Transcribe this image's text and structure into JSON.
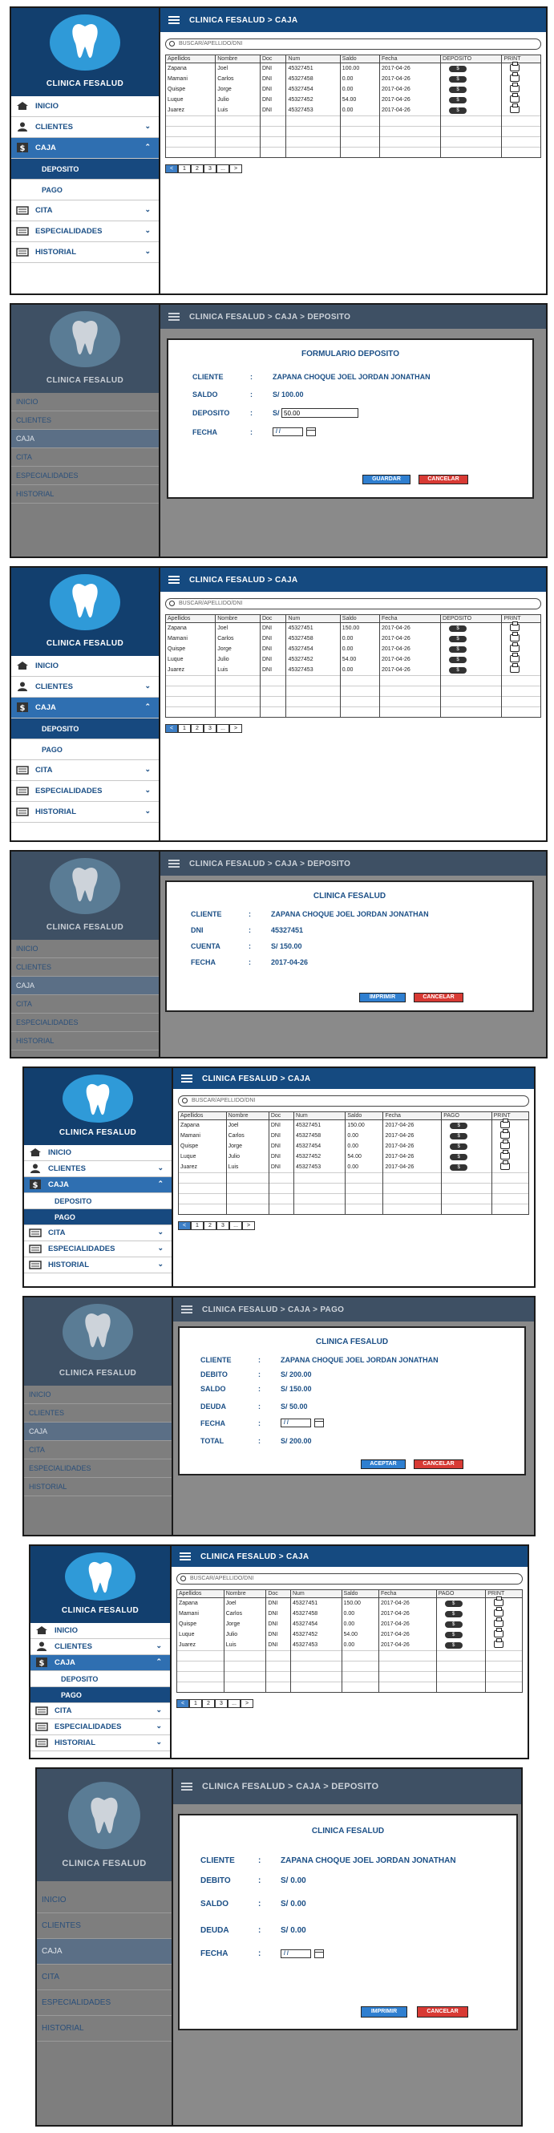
{
  "app": {
    "name": "CLINICA FESALUD"
  },
  "nav": {
    "inicio": "INICIO",
    "clientes": "CLIENTES",
    "caja": "CAJA",
    "deposito": "DEPOSITO",
    "pago": "PAGO",
    "cita": "CITA",
    "especialidades": "ESPECIALIDADES",
    "historial": "HISTORIAL"
  },
  "breadcrumbs": {
    "caja": "CLINICA FESALUD  >  CAJA",
    "deposito": "CLINICA FESALUD  >  CAJA  >  DEPOSITO",
    "pago": "CLINICA FESALUD  >  CAJA  >  PAGO"
  },
  "search": {
    "placeholder": "BUSCAR/APELLIDO/DNI"
  },
  "table": {
    "headers": [
      "Apellidos",
      "Nombre",
      "Doc",
      "Num",
      "Saldo",
      "Fecha",
      "DEPOSITO",
      "PRINT"
    ],
    "headers_pago": [
      "Apellidos",
      "Nombre",
      "Doc",
      "Num",
      "Saldo",
      "Fecha",
      "PAGO",
      "PRINT"
    ],
    "rows": [
      [
        "Zapana",
        "Joel",
        "DNI",
        "45327451",
        "100.00",
        "2017-04-26"
      ],
      [
        "Mamani",
        "Carlos",
        "DNI",
        "45327458",
        "0.00",
        "2017-04-26"
      ],
      [
        "Quispe",
        "Jorge",
        "DNI",
        "45327454",
        "0.00",
        "2017-04-26"
      ],
      [
        "Luque",
        "Julio",
        "DNI",
        "45327452",
        "54.00",
        "2017-04-26"
      ],
      [
        "Juarez",
        "Luis",
        "DNI",
        "45327453",
        "0.00",
        "2017-04-26"
      ]
    ],
    "rows_s3": [
      [
        "Zapana",
        "Joel",
        "DNI",
        "45327451",
        "150.00",
        "2017-04-26"
      ],
      [
        "Mamani",
        "Carlos",
        "DNI",
        "45327458",
        "0.00",
        "2017-04-26"
      ],
      [
        "Quispe",
        "Jorge",
        "DNI",
        "45327454",
        "0.00",
        "2017-04-26"
      ],
      [
        "Luque",
        "Julio",
        "DNI",
        "45327452",
        "54.00",
        "2017-04-26"
      ],
      [
        "Juarez",
        "Luis",
        "DNI",
        "45327453",
        "0.00",
        "2017-04-26"
      ]
    ],
    "action_label": "$"
  },
  "pager": [
    "<",
    "1",
    "2",
    "3",
    "...",
    ">"
  ],
  "deposito_form": {
    "title": "FORMULARIO DEPOSITO",
    "cliente_label": "CLIENTE",
    "cliente_value": "ZAPANA CHOQUE JOEL JORDAN JONATHAN",
    "saldo_label": "SALDO",
    "saldo_value": "S/ 100.00",
    "deposito_label": "DEPOSITO",
    "deposito_prefix": "S/",
    "deposito_value": "50.00",
    "fecha_label": "FECHA",
    "fecha_value": "/ /",
    "guardar": "GUARDAR",
    "cancelar": "CANCELAR"
  },
  "recibo_deposito": {
    "title": "CLINICA FESALUD",
    "cliente_label": "CLIENTE",
    "cliente_value": "ZAPANA CHOQUE JOEL JORDAN JONATHAN",
    "dni_label": "DNI",
    "dni_value": "45327451",
    "cuenta_label": "CUENTA",
    "cuenta_value": "S/ 150.00",
    "fecha_label": "FECHA",
    "fecha_value": "2017-04-26",
    "imprimir": "IMPRIMIR",
    "cancelar": "CANCELAR"
  },
  "pago_form": {
    "title": "CLINICA FESALUD",
    "cliente_label": "CLIENTE",
    "cliente_value": "ZAPANA CHOQUE JOEL JORDAN JONATHAN",
    "debito_label": "DEBITO",
    "debito_value": "S/ 200.00",
    "saldo_label": "SALDO",
    "saldo_value": "S/ 150.00",
    "deuda_label": "DEUDA",
    "deuda_value": "S/ 50.00",
    "fecha_label": "FECHA",
    "fecha_value": "/ /",
    "total_label": "TOTAL",
    "total_value": "S/ 200.00",
    "aceptar": "ACEPTAR",
    "cancelar": "CANCELAR"
  },
  "recibo_pago": {
    "title": "CLINICA FESALUD",
    "cliente_label": "CLIENTE",
    "cliente_value": "ZAPANA CHOQUE JOEL JORDAN JONATHAN",
    "debito_label": "DEBITO",
    "debito_value": "S/ 0.00",
    "saldo_label": "SALDO",
    "saldo_value": "S/ 0.00",
    "deuda_label": "DEUDA",
    "deuda_value": "S/ 0.00",
    "fecha_label": "FECHA",
    "fecha_value": "/ /",
    "imprimir": "IMPRIMIR",
    "cancelar": "CANCELAR"
  },
  "colors": {
    "navy": "#154a80",
    "accent_blue": "#2f9ad8",
    "active": "#2f6fb1",
    "button_blue": "#2f7fd0",
    "button_red": "#d83a34"
  }
}
